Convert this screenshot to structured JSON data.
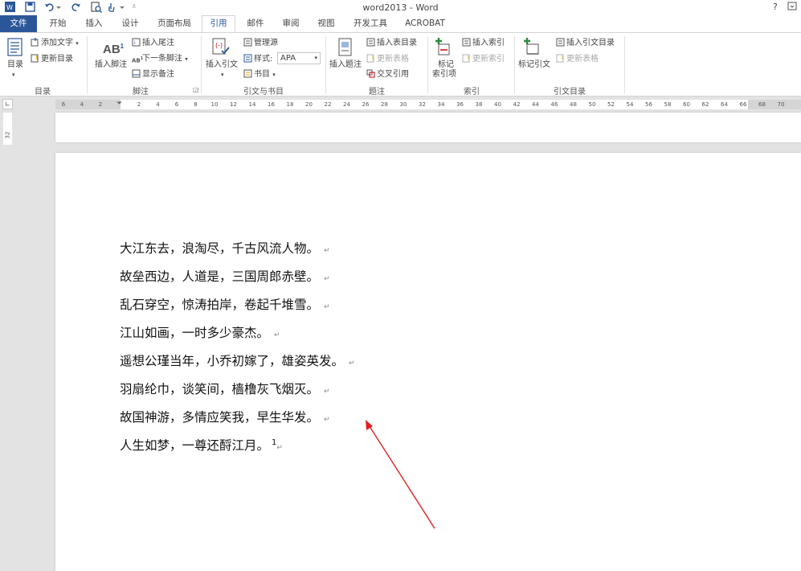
{
  "window": {
    "title": "word2013 - Word",
    "help_label": "?"
  },
  "tabs": [
    {
      "label": "文件"
    },
    {
      "label": "开始"
    },
    {
      "label": "插入"
    },
    {
      "label": "设计"
    },
    {
      "label": "页面布局"
    },
    {
      "label": "引用"
    },
    {
      "label": "邮件"
    },
    {
      "label": "审阅"
    },
    {
      "label": "视图"
    },
    {
      "label": "开发工具"
    },
    {
      "label": "ACROBAT"
    }
  ],
  "ribbon": {
    "toc": {
      "group_label": "目录",
      "toc_button": "目录",
      "add_text": "添加文字",
      "update_toc": "更新目录"
    },
    "footnotes": {
      "group_label": "脚注",
      "insert_footnote": "插入脚注",
      "insert_endnote": "插入尾注",
      "next_footnote": "下一条脚注",
      "show_notes": "显示备注"
    },
    "citations": {
      "group_label": "引文与书目",
      "insert_citation": "插入引文",
      "manage_sources": "管理源",
      "style_label": "样式:",
      "style_value": "APA",
      "bibliography": "书目"
    },
    "captions": {
      "group_label": "题注",
      "insert_caption": "插入题注",
      "insert_table_of_figures": "插入表目录",
      "update_table": "更新表格",
      "cross_reference": "交叉引用"
    },
    "index": {
      "group_label": "索引",
      "mark_entry_line1": "标记",
      "mark_entry_line2": "索引项",
      "insert_index": "插入索引",
      "update_index": "更新索引"
    },
    "authorities": {
      "group_label": "引文目录",
      "mark_citation": "标记引文",
      "insert_toa": "插入引文目录",
      "update_table": "更新表格"
    }
  },
  "ruler": {
    "ticks": [
      "6",
      "4",
      "2",
      "2",
      "4",
      "6",
      "8",
      "10",
      "12",
      "14",
      "16",
      "18",
      "20",
      "22",
      "24",
      "26",
      "28",
      "30",
      "32",
      "34",
      "36",
      "38",
      "40",
      "42",
      "44",
      "46",
      "48",
      "50",
      "52",
      "54",
      "56",
      "58",
      "60",
      "62",
      "64",
      "66",
      "68",
      "70"
    ],
    "vertical_number": "32"
  },
  "document": {
    "lines": [
      "大江东去，浪淘尽，千古风流人物。",
      "故垒西边，人道是，三国周郎赤壁。",
      "乱石穿空，惊涛拍岸，卷起千堆雪。",
      "江山如画，一时多少豪杰。",
      "遥想公瑾当年，小乔初嫁了，雄姿英发。",
      "羽扇纶巾，谈笑间，樯橹灰飞烟灭。",
      "故国神游，多情应笑我，早生华发。",
      "人生如梦，一尊还酹江月。"
    ],
    "paragraph_mark": "↵",
    "footnote_ref": "1"
  },
  "colors": {
    "accent": "#2b579a",
    "annotation_arrow": "#e02020"
  }
}
